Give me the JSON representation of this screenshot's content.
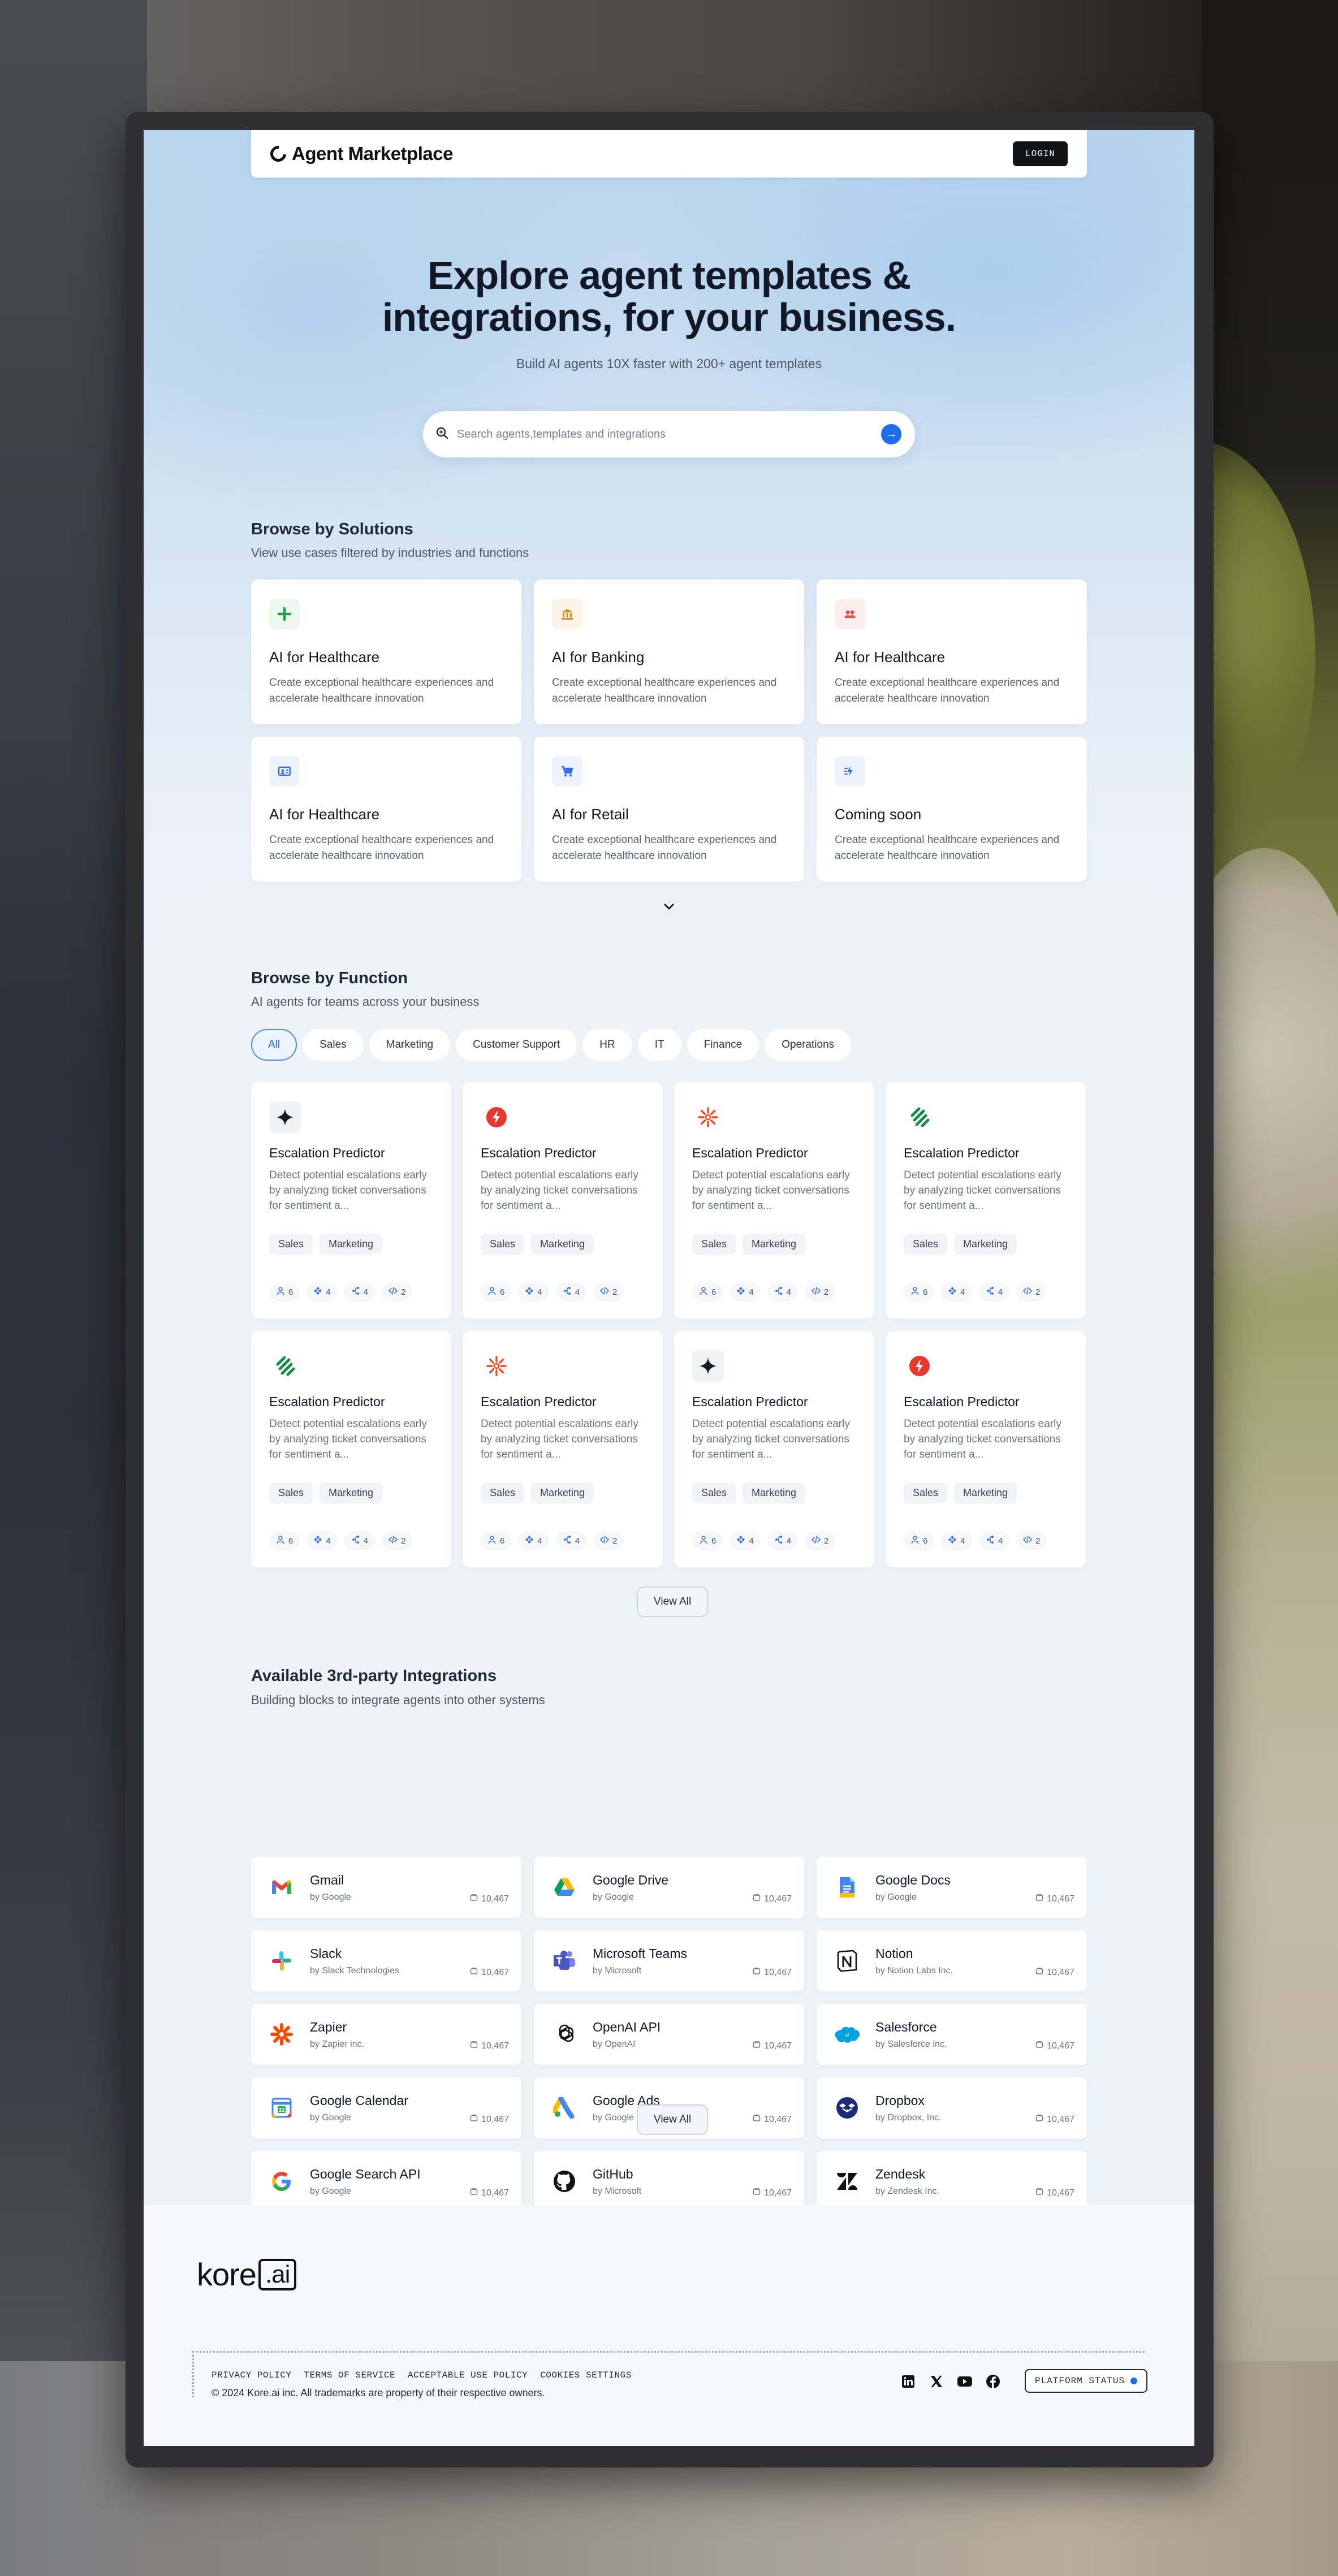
{
  "nav": {
    "brand": "Agent Marketplace",
    "login": "LOGIN"
  },
  "hero": {
    "title_line1": "Explore agent templates &",
    "title_line2": "integrations, for your business.",
    "subtitle": "Build AI agents 10X faster with 200+ agent templates",
    "search_placeholder": "Search agents,templates and integrations"
  },
  "solutions": {
    "title": "Browse by Solutions",
    "subtitle": "View use cases filtered by industries and functions",
    "cards": [
      {
        "title": "AI for Healthcare",
        "desc": "Create exceptional healthcare experiences and accelerate healthcare innovation",
        "icon": "plus-icon",
        "color": "#1f9d55"
      },
      {
        "title": "AI for Banking",
        "desc": "Create exceptional healthcare experiences and accelerate healthcare innovation",
        "icon": "bank-icon",
        "color": "#e08a1e"
      },
      {
        "title": "AI for Healthcare",
        "desc": "Create exceptional healthcare experiences and accelerate healthcare innovation",
        "icon": "people-icon",
        "color": "#e5484d"
      },
      {
        "title": "AI for Healthcare",
        "desc": "Create exceptional healthcare experiences and accelerate healthcare innovation",
        "icon": "id-card-icon",
        "color": "#2f6fe0"
      },
      {
        "title": "AI for Retail",
        "desc": "Create exceptional healthcare experiences and accelerate healthcare innovation",
        "icon": "cart-icon",
        "color": "#2f6fe0"
      },
      {
        "title": "Coming soon",
        "desc": "Create exceptional healthcare experiences and accelerate healthcare innovation",
        "icon": "sparkle-bolt-icon",
        "color": "#2f6fe0"
      }
    ]
  },
  "functions": {
    "title": "Browse by Function",
    "subtitle": "AI agents for teams across your business",
    "tabs": [
      "All",
      "Sales",
      "Marketing",
      "Customer Support",
      "HR",
      "IT",
      "Finance",
      "Operations"
    ],
    "agents": [
      {
        "title": "Escalation Predictor",
        "desc": "Detect potential escalations early by analyzing ticket conversations for sentiment a...",
        "icon": "sparkle-icon",
        "tags": [
          "Sales",
          "Marketing"
        ],
        "stats": [
          "6",
          "4",
          "4",
          "2"
        ]
      },
      {
        "title": "Escalation Predictor",
        "desc": "Detect potential escalations early by analyzing ticket conversations for sentiment a...",
        "icon": "bolt-icon",
        "tags": [
          "Sales",
          "Marketing"
        ],
        "stats": [
          "6",
          "4",
          "4",
          "2"
        ]
      },
      {
        "title": "Escalation Predictor",
        "desc": "Detect potential escalations early by analyzing ticket conversations for sentiment a...",
        "icon": "sunburst-icon",
        "tags": [
          "Sales",
          "Marketing"
        ],
        "stats": [
          "6",
          "4",
          "4",
          "2"
        ]
      },
      {
        "title": "Escalation Predictor",
        "desc": "Detect potential escalations early by analyzing ticket conversations for sentiment a...",
        "icon": "stripes-icon",
        "tags": [
          "Sales",
          "Marketing"
        ],
        "stats": [
          "6",
          "4",
          "4",
          "2"
        ]
      },
      {
        "title": "Escalation Predictor",
        "desc": "Detect potential escalations early by analyzing ticket conversations for sentiment a...",
        "icon": "stripes-icon",
        "tags": [
          "Sales",
          "Marketing"
        ],
        "stats": [
          "6",
          "4",
          "4",
          "2"
        ]
      },
      {
        "title": "Escalation Predictor",
        "desc": "Detect potential escalations early by analyzing ticket conversations for sentiment a...",
        "icon": "sunburst-icon",
        "tags": [
          "Sales",
          "Marketing"
        ],
        "stats": [
          "6",
          "4",
          "4",
          "2"
        ]
      },
      {
        "title": "Escalation Predictor",
        "desc": "Detect potential escalations early by analyzing ticket conversations for sentiment a...",
        "icon": "sparkle-icon",
        "tags": [
          "Sales",
          "Marketing"
        ],
        "stats": [
          "6",
          "4",
          "4",
          "2"
        ]
      },
      {
        "title": "Escalation Predictor",
        "desc": "Detect potential escalations early by analyzing ticket conversations for sentiment a...",
        "icon": "bolt-icon",
        "tags": [
          "Sales",
          "Marketing"
        ],
        "stats": [
          "6",
          "4",
          "4",
          "2"
        ]
      }
    ],
    "view_all": "View All"
  },
  "integrations": {
    "title": "Available 3rd-party Integrations",
    "subtitle": "Building blocks to integrate agents into other systems",
    "items": [
      {
        "name": "Gmail",
        "by": "by Google",
        "count": "10,467",
        "icon": "gmail-icon"
      },
      {
        "name": "Google Drive",
        "by": "by Google",
        "count": "10,467",
        "icon": "google-drive-icon"
      },
      {
        "name": "Google Docs",
        "by": "by Google",
        "count": "10,467",
        "icon": "google-docs-icon"
      },
      {
        "name": "Slack",
        "by": "by Slack Technologies",
        "count": "10,467",
        "icon": "slack-icon"
      },
      {
        "name": "Microsoft Teams",
        "by": "by Microsoft",
        "count": "10,467",
        "icon": "teams-icon"
      },
      {
        "name": "Notion",
        "by": "by Notion Labs Inc.",
        "count": "10,467",
        "icon": "notion-icon"
      },
      {
        "name": "Zapier",
        "by": "by Zapier inc.",
        "count": "10,467",
        "icon": "zapier-icon"
      },
      {
        "name": "OpenAI API",
        "by": "by OpenAI",
        "count": "10,467",
        "icon": "openai-icon"
      },
      {
        "name": "Salesforce",
        "by": "by Salesforce inc.",
        "count": "10,467",
        "icon": "salesforce-icon"
      },
      {
        "name": "Google Calendar",
        "by": "by Google",
        "count": "10,467",
        "icon": "google-calendar-icon"
      },
      {
        "name": "Google Ads",
        "by": "by Google",
        "count": "10,467",
        "icon": "google-ads-icon"
      },
      {
        "name": "Dropbox",
        "by": "by Dropbox, Inc.",
        "count": "10,467",
        "icon": "dropbox-icon"
      },
      {
        "name": "Google Search API",
        "by": "by Google",
        "count": "10,467",
        "icon": "google-icon"
      },
      {
        "name": "GitHub",
        "by": "by Microsoft",
        "count": "10,467",
        "icon": "github-icon"
      },
      {
        "name": "Zendesk",
        "by": "by Zendesk Inc.",
        "count": "10,467",
        "icon": "zendesk-icon"
      }
    ],
    "view_all": "View All"
  },
  "footer": {
    "logo_text": "kore",
    "logo_box": ".ai",
    "links": [
      "PRIVACY POLICY",
      "TERMS OF SERVICE",
      "ACCEPTABLE USE POLICY",
      "COOKIES SETTINGS"
    ],
    "copyright": "© 2024 Kore.ai inc. All trademarks are property of their respective owners.",
    "status": "PLATFORM STATUS"
  },
  "colors": {
    "accent": "#1f6be8",
    "active_tab": "#2463d9"
  }
}
